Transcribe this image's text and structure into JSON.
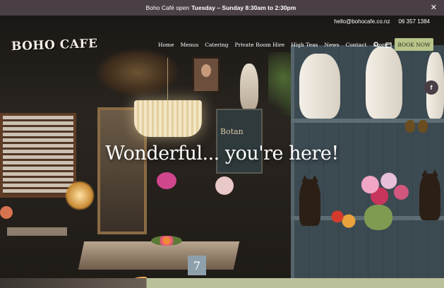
{
  "announcement": {
    "prefix": "Boho Café open",
    "days": "Tuesday – Sunday 8:30am to 2:30pm",
    "close_icon": "close-icon"
  },
  "contact": {
    "email": "hello@bohocafe.co.nz",
    "phone": "06 357 1384"
  },
  "logo": {
    "text": "BOHO CAFE"
  },
  "nav": {
    "items": [
      {
        "label": "Home"
      },
      {
        "label": "Menus"
      },
      {
        "label": "Catering"
      },
      {
        "label": "Private Room Hire"
      },
      {
        "label": "High Teas"
      },
      {
        "label": "News"
      },
      {
        "label": "Contact"
      },
      {
        "label": "Store"
      }
    ],
    "search_icon": "search-icon",
    "calendar_icon": "calendar-icon",
    "book_label": "BOOK NOW"
  },
  "social": {
    "facebook_label": "f"
  },
  "hero": {
    "headline": "Wonderful... you're here!",
    "board_text": "Botan",
    "table_number": "7"
  },
  "colors": {
    "announcement_bg": "#4a3f47",
    "book_button": "#b7c58a",
    "shelf_blue": "#3c4a52"
  }
}
